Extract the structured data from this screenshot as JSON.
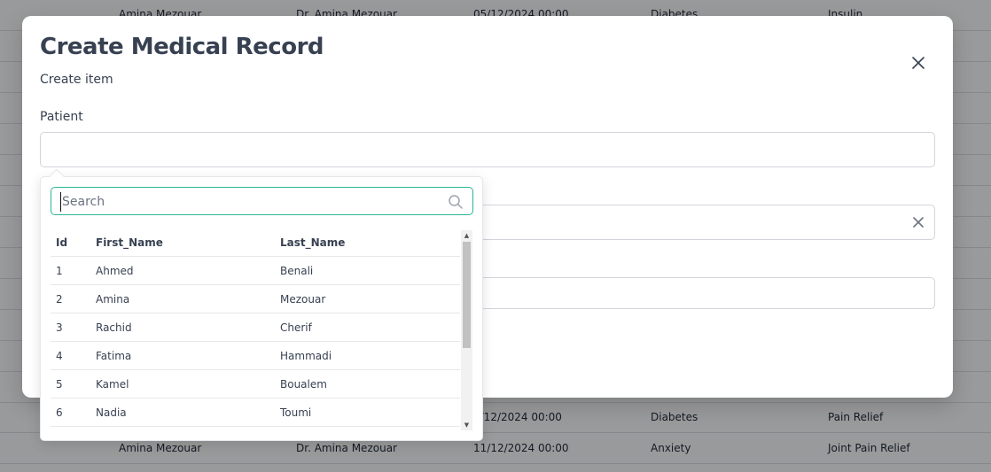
{
  "background_rows": [
    {
      "patient": "Amina Mezouar",
      "doctor": "Dr. Amina Mezouar",
      "date": "05/12/2024 00:00",
      "diagnosis": "Diabetes",
      "treatment": "Insulin"
    },
    {
      "patient": "",
      "doctor": "",
      "date": "3/12/2024 00:00",
      "diagnosis": "Diabetes",
      "treatment": "Pain Relief"
    },
    {
      "patient": "Amina Mezouar",
      "doctor": "Dr. Amina Mezouar",
      "date": "11/12/2024 00:00",
      "diagnosis": "Anxiety",
      "treatment": "Joint Pain Relief"
    }
  ],
  "modal": {
    "title": "Create Medical Record",
    "subtitle": "Create item",
    "patient_label": "Patient",
    "patient_value": ""
  },
  "dropdown": {
    "search_placeholder": "Search",
    "columns": [
      "Id",
      "First_Name",
      "Last_Name"
    ],
    "rows": [
      {
        "id": "1",
        "first_name": "Ahmed",
        "last_name": "Benali"
      },
      {
        "id": "2",
        "first_name": "Amina",
        "last_name": "Mezouar"
      },
      {
        "id": "3",
        "first_name": "Rachid",
        "last_name": "Cherif"
      },
      {
        "id": "4",
        "first_name": "Fatima",
        "last_name": "Hammadi"
      },
      {
        "id": "5",
        "first_name": "Kamel",
        "last_name": "Boualem"
      },
      {
        "id": "6",
        "first_name": "Nadia",
        "last_name": "Toumi"
      }
    ]
  },
  "icons": {
    "close": "close-icon",
    "clear": "clear-icon",
    "search": "search-icon",
    "scroll_up": "chevron-up-icon",
    "scroll_down": "chevron-down-icon"
  },
  "colors": {
    "accent": "#2bb495",
    "title": "#374151",
    "border": "#d1d5db"
  }
}
